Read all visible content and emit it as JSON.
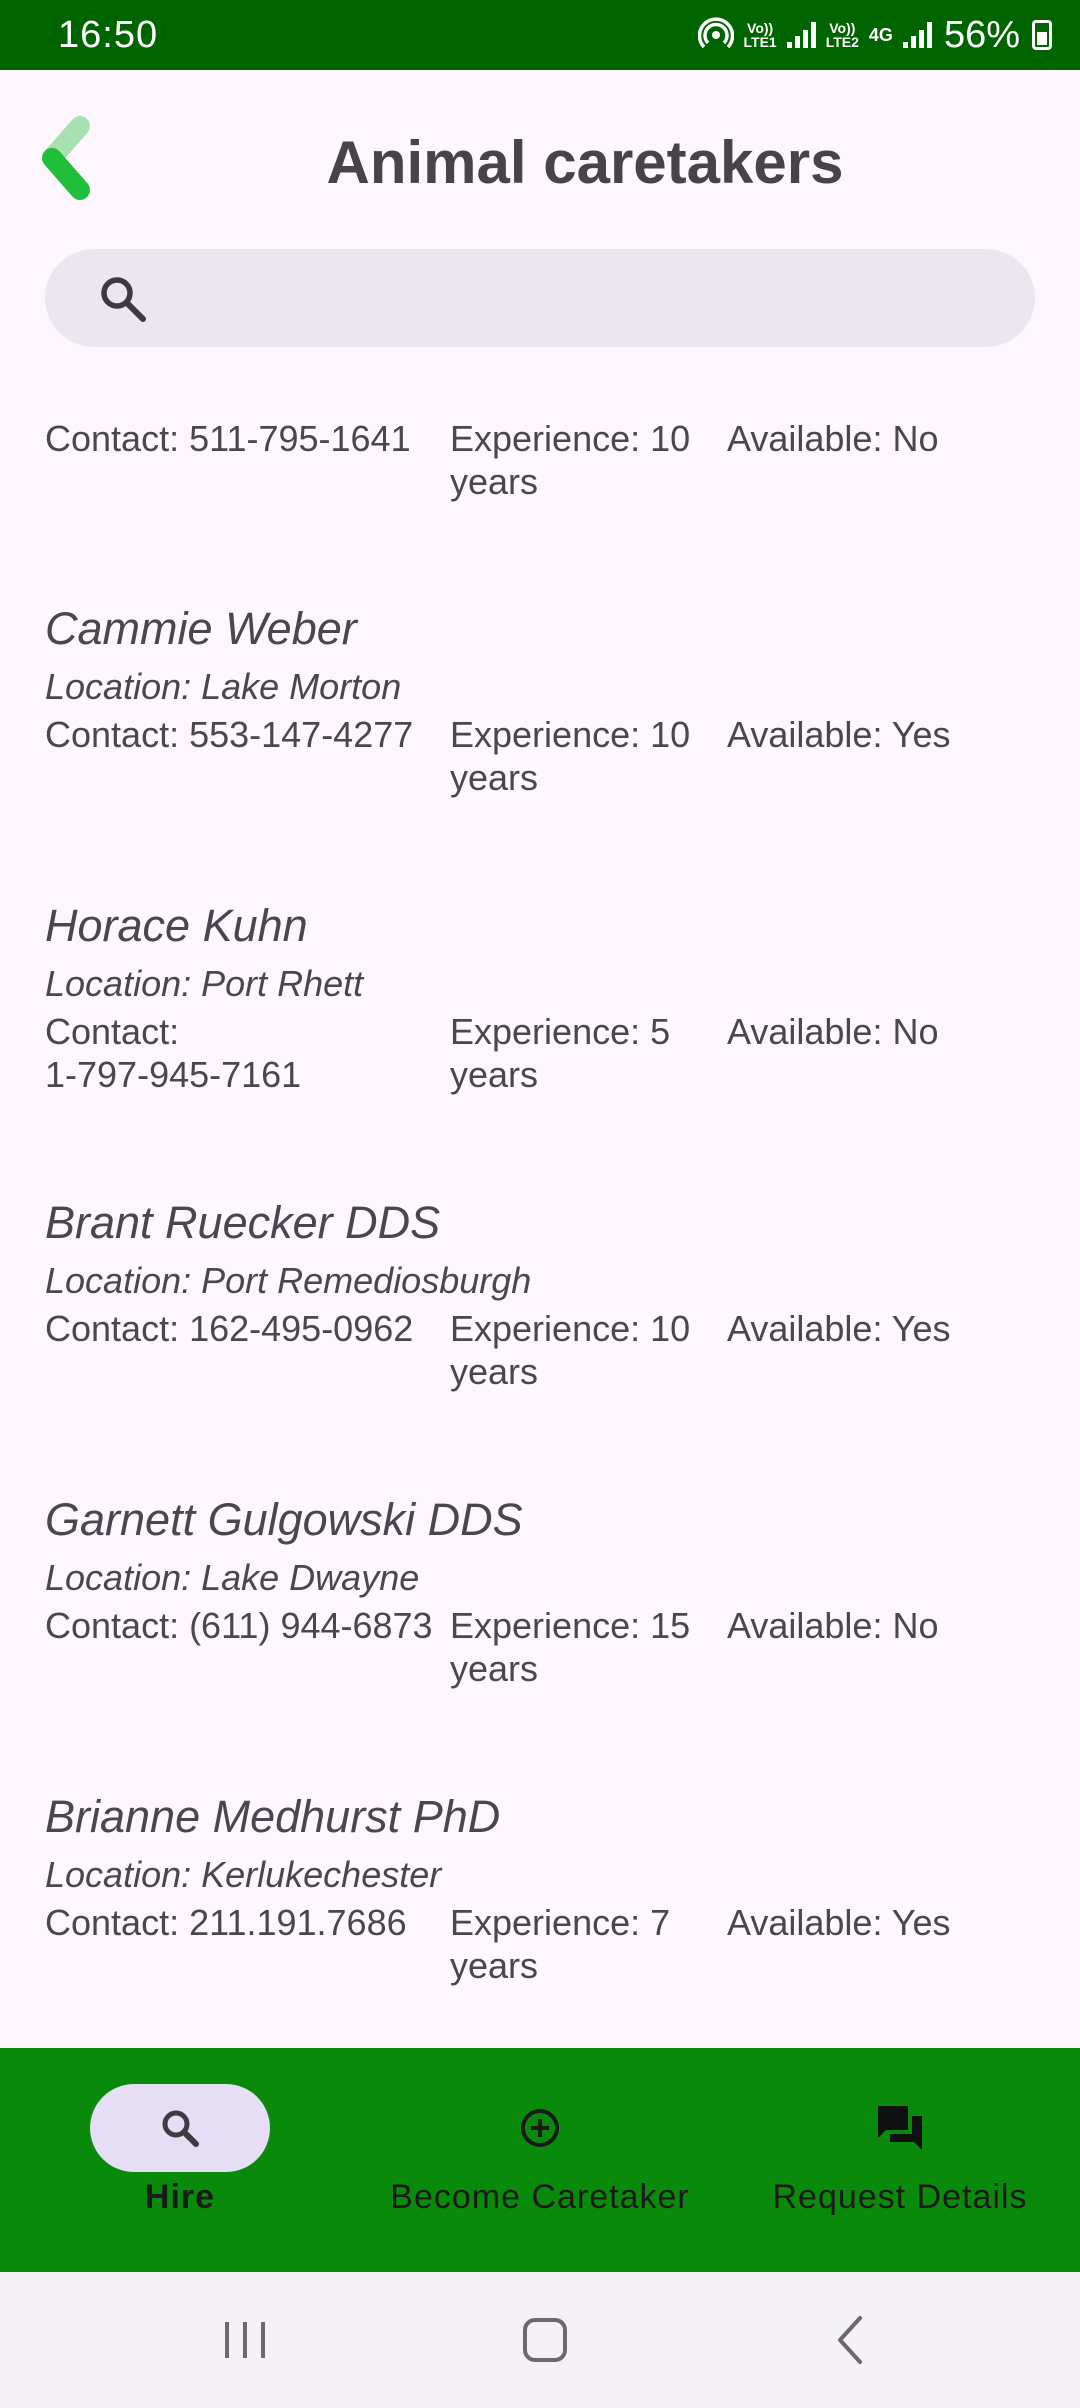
{
  "status_bar": {
    "time": "16:50",
    "battery": "56%",
    "sim1_label": "Vo)) LTE1",
    "sim2_label": "Vo)) LTE2",
    "net_type": "4G"
  },
  "header": {
    "title": "Animal caretakers",
    "back_icon": "chevron-left-icon"
  },
  "search": {
    "placeholder": "",
    "value": "",
    "icon": "search-icon"
  },
  "caretakers": [
    {
      "name": "",
      "location": "",
      "contact_lines": [
        "Contact: 511-795-1641"
      ],
      "experience_lines": [
        "Experience: 10",
        "years"
      ],
      "available": "Available: No"
    },
    {
      "name": "Cammie Weber",
      "location": "Location: Lake Morton",
      "contact_lines": [
        "Contact: 553-147-4277"
      ],
      "experience_lines": [
        "Experience: 10",
        "years"
      ],
      "available": "Available: Yes"
    },
    {
      "name": "Horace Kuhn",
      "location": "Location: Port Rhett",
      "contact_lines": [
        "Contact:",
        "1-797-945-7161"
      ],
      "experience_lines": [
        "Experience: 5",
        "years"
      ],
      "available": "Available: No"
    },
    {
      "name": "Brant Ruecker DDS",
      "location": "Location: Port Remediosburgh",
      "contact_lines": [
        "Contact: 162-495-0962"
      ],
      "experience_lines": [
        "Experience: 10",
        "years"
      ],
      "available": "Available: Yes"
    },
    {
      "name": "Garnett Gulgowski DDS",
      "location": "Location: Lake Dwayne",
      "contact_lines": [
        "Contact: (611) 944-6873"
      ],
      "experience_lines": [
        "Experience: 15",
        "years"
      ],
      "available": "Available: No"
    },
    {
      "name": "Brianne Medhurst PhD",
      "location": "Location: Kerlukechester",
      "contact_lines": [
        "Contact: 211.191.7686"
      ],
      "experience_lines": [
        "Experience: 7",
        "years"
      ],
      "available": "Available: Yes"
    }
  ],
  "bottom_nav": {
    "items": [
      {
        "label": "Hire",
        "icon": "search-icon",
        "active": true
      },
      {
        "label": "Become Caretaker",
        "icon": "add-circle-icon",
        "active": false
      },
      {
        "label": "Request Details",
        "icon": "chat-icon",
        "active": false
      }
    ]
  },
  "colors": {
    "status_bar": "#006400",
    "bottom_nav": "#0a8a0a",
    "background": "#fdf7fd",
    "active_pill": "#e5def4",
    "back_icon_green": "#1fbf3a"
  }
}
